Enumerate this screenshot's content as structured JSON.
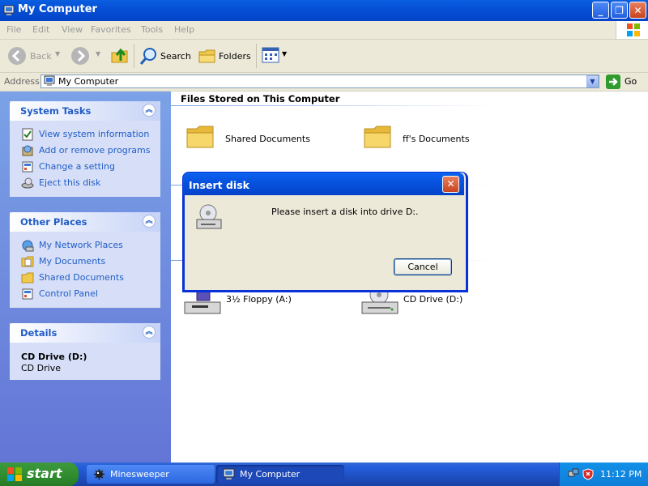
{
  "window": {
    "title": "My Computer"
  },
  "menu": [
    "File",
    "Edit",
    "View",
    "Favorites",
    "Tools",
    "Help"
  ],
  "toolbar": {
    "back": "Back",
    "search": "Search",
    "folders": "Folders"
  },
  "address": {
    "label": "Address",
    "value": "My Computer",
    "go": "Go"
  },
  "left": {
    "system_tasks": {
      "title": "System Tasks",
      "items": [
        "View system information",
        "Add or remove programs",
        "Change a setting",
        "Eject this disk"
      ]
    },
    "other_places": {
      "title": "Other Places",
      "items": [
        "My Network Places",
        "My Documents",
        "Shared Documents",
        "Control Panel"
      ]
    },
    "details": {
      "title": "Details",
      "name": "CD Drive (D:)",
      "type": "CD Drive"
    }
  },
  "main": {
    "section1": "Files Stored on This Computer",
    "folders": [
      "Shared Documents",
      "ff's Documents"
    ],
    "drives": [
      "3½ Floppy (A:)",
      "CD Drive (D:)"
    ]
  },
  "dialog": {
    "title": "Insert disk",
    "message": "Please insert a disk into drive D:.",
    "cancel": "Cancel"
  },
  "taskbar": {
    "start": "start",
    "tasks": [
      "Minesweeper",
      "My Computer"
    ],
    "time": "11:12 PM"
  },
  "colors": {
    "title_blue": "#0650d6",
    "link_blue": "#215dc6",
    "start_green": "#2e8b2e"
  }
}
